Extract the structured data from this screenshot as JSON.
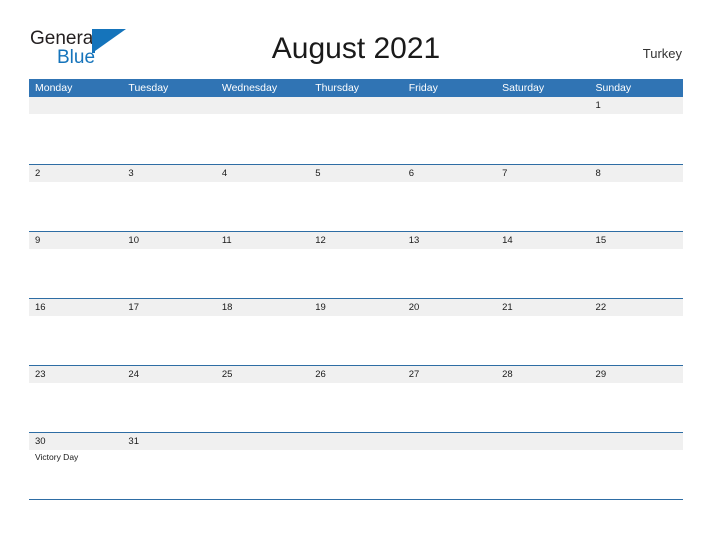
{
  "brand": {
    "name_part1": "General",
    "name_part2": "Blue",
    "flag_icon": "flag-icon",
    "color_primary": "#1574bb"
  },
  "header": {
    "title": "August 2021",
    "region": "Turkey"
  },
  "theme": {
    "header_blue": "#3074b4",
    "separator_blue": "#2e6da4",
    "date_band_gray": "#f0f0f0",
    "text_dark": "#1a1a1a"
  },
  "calendar": {
    "month": "August",
    "year": "2021",
    "weekday_headers": [
      "Monday",
      "Tuesday",
      "Wednesday",
      "Thursday",
      "Friday",
      "Saturday",
      "Sunday"
    ],
    "weeks": [
      {
        "days": [
          {
            "date": "",
            "events": []
          },
          {
            "date": "",
            "events": []
          },
          {
            "date": "",
            "events": []
          },
          {
            "date": "",
            "events": []
          },
          {
            "date": "",
            "events": []
          },
          {
            "date": "",
            "events": []
          },
          {
            "date": "1",
            "events": []
          }
        ]
      },
      {
        "days": [
          {
            "date": "2",
            "events": []
          },
          {
            "date": "3",
            "events": []
          },
          {
            "date": "4",
            "events": []
          },
          {
            "date": "5",
            "events": []
          },
          {
            "date": "6",
            "events": []
          },
          {
            "date": "7",
            "events": []
          },
          {
            "date": "8",
            "events": []
          }
        ]
      },
      {
        "days": [
          {
            "date": "9",
            "events": []
          },
          {
            "date": "10",
            "events": []
          },
          {
            "date": "11",
            "events": []
          },
          {
            "date": "12",
            "events": []
          },
          {
            "date": "13",
            "events": []
          },
          {
            "date": "14",
            "events": []
          },
          {
            "date": "15",
            "events": []
          }
        ]
      },
      {
        "days": [
          {
            "date": "16",
            "events": []
          },
          {
            "date": "17",
            "events": []
          },
          {
            "date": "18",
            "events": []
          },
          {
            "date": "19",
            "events": []
          },
          {
            "date": "20",
            "events": []
          },
          {
            "date": "21",
            "events": []
          },
          {
            "date": "22",
            "events": []
          }
        ]
      },
      {
        "days": [
          {
            "date": "23",
            "events": []
          },
          {
            "date": "24",
            "events": []
          },
          {
            "date": "25",
            "events": []
          },
          {
            "date": "26",
            "events": []
          },
          {
            "date": "27",
            "events": []
          },
          {
            "date": "28",
            "events": []
          },
          {
            "date": "29",
            "events": []
          }
        ]
      },
      {
        "days": [
          {
            "date": "30",
            "events": [
              "Victory Day"
            ]
          },
          {
            "date": "31",
            "events": []
          },
          {
            "date": "",
            "events": []
          },
          {
            "date": "",
            "events": []
          },
          {
            "date": "",
            "events": []
          },
          {
            "date": "",
            "events": []
          },
          {
            "date": "",
            "events": []
          }
        ]
      }
    ]
  }
}
